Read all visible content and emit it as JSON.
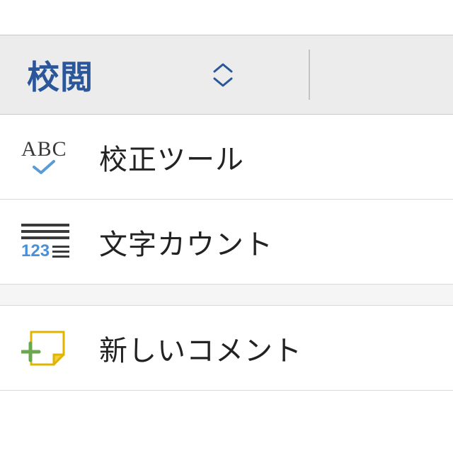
{
  "header": {
    "title": "校閲"
  },
  "items": [
    {
      "label": "校正ツール",
      "icon": "proofing"
    },
    {
      "label": "文字カウント",
      "icon": "word-count"
    },
    {
      "label": "新しいコメント",
      "icon": "new-comment"
    }
  ]
}
